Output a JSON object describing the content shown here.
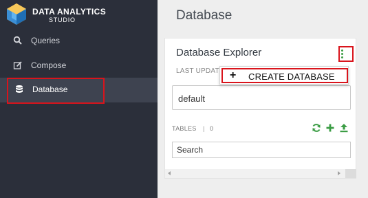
{
  "brand": {
    "title": "DATA ANALYTICS",
    "subtitle": "STUDIO",
    "logo_icon": "hexagon-cube-logo"
  },
  "sidebar": {
    "items": [
      {
        "label": "Queries",
        "icon": "search-icon"
      },
      {
        "label": "Compose",
        "icon": "edit-icon"
      },
      {
        "label": "Database",
        "icon": "database-icon",
        "active": true
      }
    ]
  },
  "main": {
    "title": "Database"
  },
  "explorer": {
    "title": "Database Explorer",
    "last_updated": "LAST UPDAT",
    "database": "default",
    "tables_label": "TABLES",
    "tables_separator": "|",
    "tables_count": "0",
    "search_placeholder": "Search",
    "actions": [
      "refresh-icon",
      "add-icon",
      "upload-icon"
    ]
  },
  "dropdown": {
    "items": [
      {
        "label": "CREATE DATABASE",
        "icon": "plus-icon",
        "plus_glyph": "+"
      }
    ]
  },
  "colors": {
    "sidebar_bg": "#2b2f3a",
    "accent_green": "#3c9d45",
    "highlight_red": "#d9141c"
  }
}
